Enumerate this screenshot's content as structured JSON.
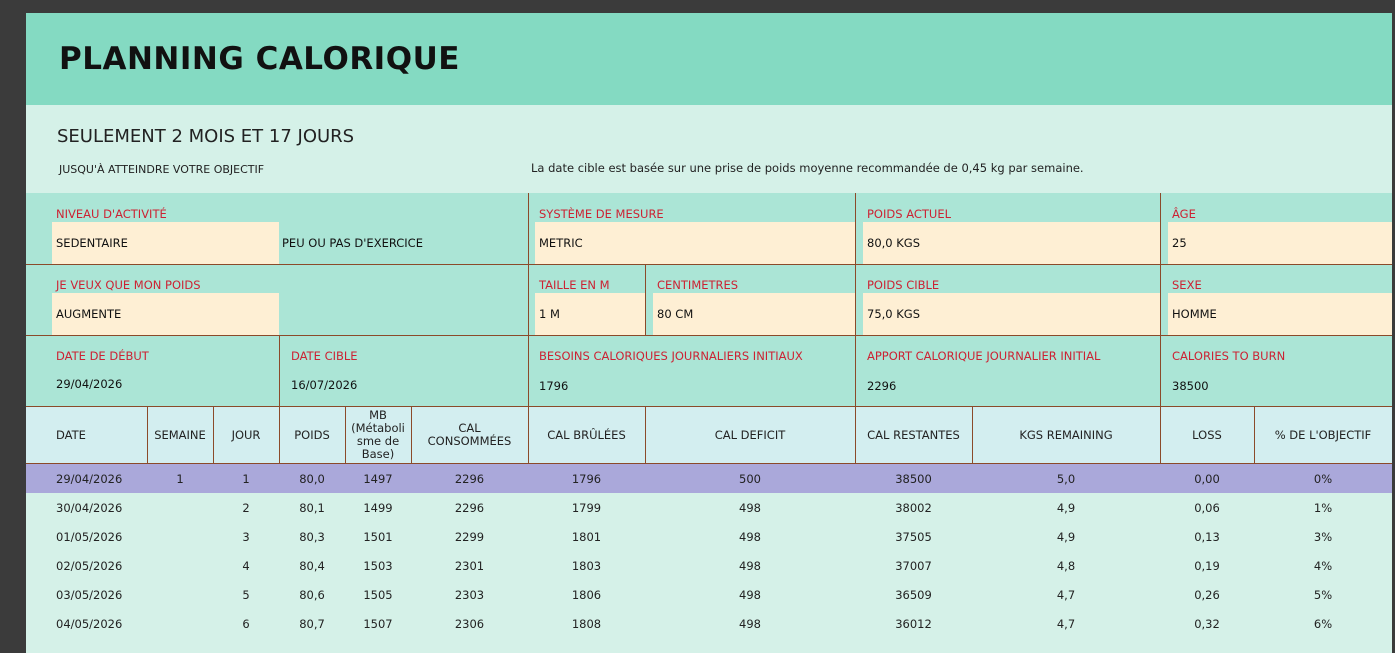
{
  "title": "PLANNING CALORIQUE",
  "subtitle": "SEULEMENT 2 MOIS ET 17 JOURS",
  "until_text": "JUSQU'À ATTEINDRE VOTRE OBJECTIF",
  "target_note": "La date cible est basée sur une prise de poids moyenne recommandée de 0,45 kg par semaine.",
  "fields": {
    "activity_level": {
      "label": "NIVEAU D'ACTIVITÉ",
      "value": "SEDENTAIRE",
      "description": "PEU OU PAS D'EXERCICE"
    },
    "measurement_system": {
      "label": "SYSTÈME DE MESURE",
      "value": "METRIC"
    },
    "current_weight": {
      "label": "POIDS ACTUEL",
      "value": "80,0 KGS"
    },
    "age": {
      "label": "ÂGE",
      "value": "25"
    },
    "weight_goal": {
      "label": "JE VEUX QUE MON POIDS",
      "value": "AUGMENTE"
    },
    "height_m": {
      "label": "TAILLE EN M",
      "value": "1 M"
    },
    "height_cm": {
      "label": "CENTIMETRES",
      "value": "80 CM"
    },
    "target_weight": {
      "label": "POIDS CIBLE",
      "value": "75,0 KGS"
    },
    "sex": {
      "label": "SEXE",
      "value": "HOMME"
    },
    "start_date": {
      "label": "DATE DE DÉBUT",
      "value": "29/04/2026"
    },
    "target_date": {
      "label": "DATE CIBLE",
      "value": "16/07/2026"
    },
    "daily_needs": {
      "label": "BESOINS CALORIQUES JOURNALIERS INITIAUX",
      "value": "1796"
    },
    "daily_intake": {
      "label": "APPORT CALORIQUE JOURNALIER INITIAL",
      "value": "2296"
    },
    "calories_to_burn": {
      "label": "CALORIES TO BURN",
      "value": "38500"
    }
  },
  "table": {
    "headers": [
      "DATE",
      "SEMAINE",
      "JOUR",
      "POIDS",
      "MB (Métaboli sme de Base)",
      "CAL CONSOMMÉES",
      "CAL BRÛLÉES",
      "CAL DEFICIT",
      "CAL RESTANTES",
      "KGS REMAINING",
      "LOSS",
      "% DE L'OBJECTIF"
    ],
    "rows": [
      [
        "29/04/2026",
        "1",
        "1",
        "80,0",
        "1497",
        "2296",
        "1796",
        "500",
        "38500",
        "5,0",
        "0,00",
        "0%"
      ],
      [
        "30/04/2026",
        "",
        "2",
        "80,1",
        "1499",
        "2296",
        "1799",
        "498",
        "38002",
        "4,9",
        "0,06",
        "1%"
      ],
      [
        "01/05/2026",
        "",
        "3",
        "80,3",
        "1501",
        "2299",
        "1801",
        "498",
        "37505",
        "4,9",
        "0,13",
        "3%"
      ],
      [
        "02/05/2026",
        "",
        "4",
        "80,4",
        "1503",
        "2301",
        "1803",
        "498",
        "37007",
        "4,8",
        "0,19",
        "4%"
      ],
      [
        "03/05/2026",
        "",
        "5",
        "80,6",
        "1505",
        "2303",
        "1806",
        "498",
        "36509",
        "4,7",
        "0,26",
        "5%"
      ],
      [
        "04/05/2026",
        "",
        "6",
        "80,7",
        "1507",
        "2306",
        "1808",
        "498",
        "36012",
        "4,7",
        "0,32",
        "6%"
      ]
    ]
  }
}
